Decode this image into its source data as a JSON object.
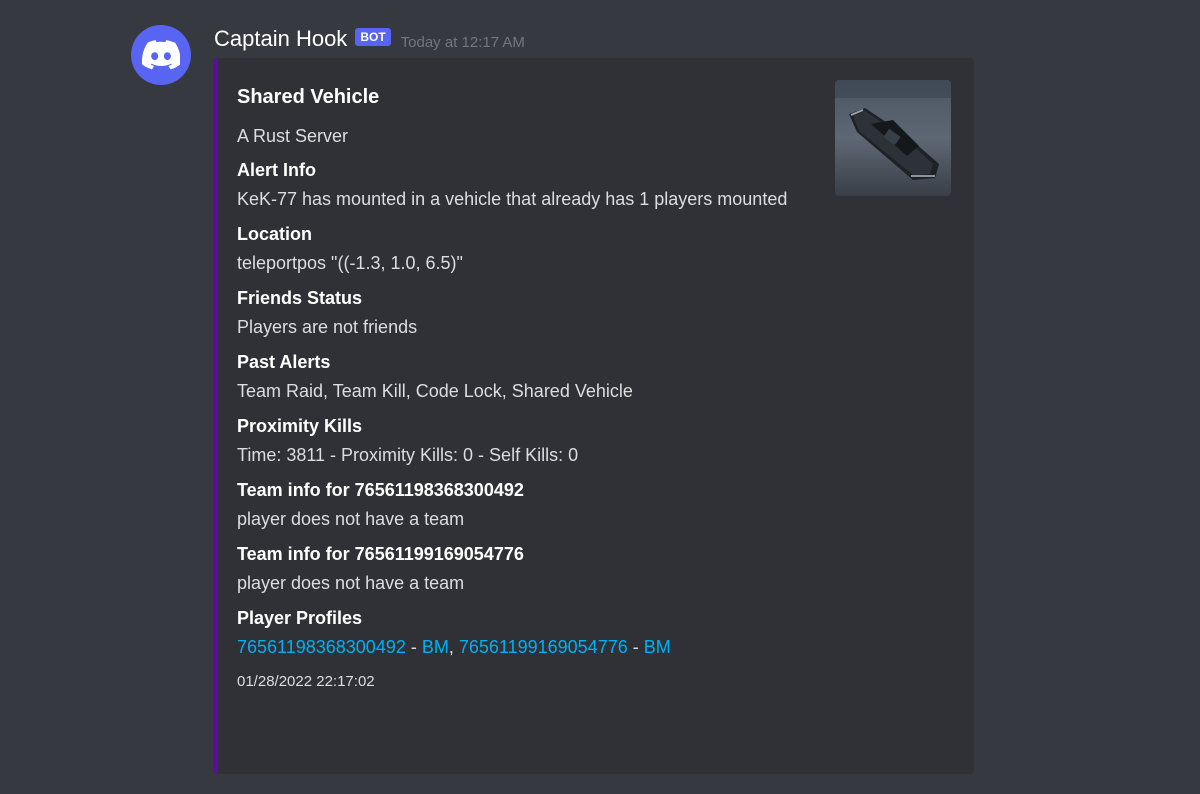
{
  "message": {
    "author": "Captain Hook",
    "bot_tag": "BOT",
    "timestamp": "Today at 12:17 AM",
    "avatar_icon": "discord-logo-icon",
    "avatar_color": "#5865f2"
  },
  "embed": {
    "accent_color": "#5b0d9e",
    "title": "Shared Vehicle",
    "description": "A Rust Server",
    "thumbnail": "boat-thumbnail",
    "fields": [
      {
        "name": "Alert Info",
        "value": "KeK-77 has mounted in a vehicle that already has 1 players mounted"
      },
      {
        "name": "Location",
        "value": "teleportpos \"((-1.3, 1.0, 6.5)\""
      },
      {
        "name": "Friends Status",
        "value": "Players are not friends"
      },
      {
        "name": "Past Alerts",
        "value": "Team Raid, Team Kill, Code Lock, Shared Vehicle"
      },
      {
        "name": "Proximity Kills",
        "value": "Time: 3811 - Proximity Kills: 0 - Self Kills: 0"
      },
      {
        "name": "Team info for 76561198368300492",
        "value": "player does not have a team"
      },
      {
        "name": "Team info for 76561199169054776",
        "value": "player does not have a team"
      }
    ],
    "profiles": {
      "name": "Player Profiles",
      "id1": "76561198368300492",
      "sep1": " - ",
      "bm1": "BM",
      "comma": ", ",
      "id2": "76561199169054776",
      "sep2": " - ",
      "bm2": "BM"
    },
    "footer": "01/28/2022 22:17:02",
    "link_color": "#00aff4"
  }
}
